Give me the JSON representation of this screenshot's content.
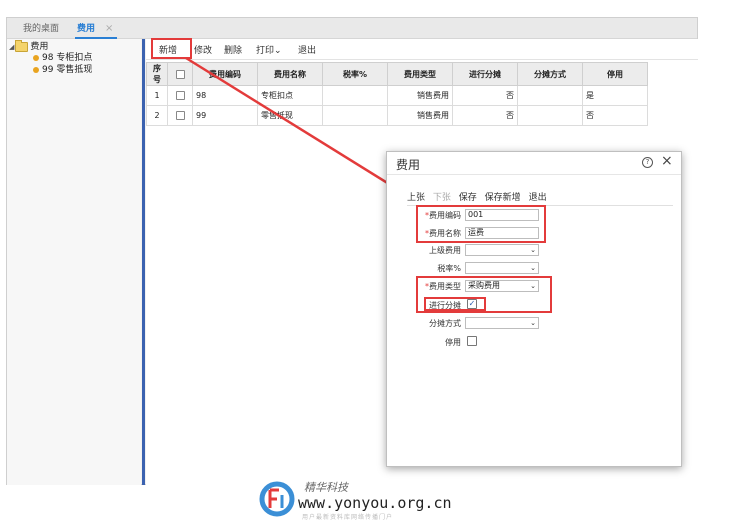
{
  "tabs": {
    "home": "我的桌面",
    "active": "费用",
    "close": "×"
  },
  "tree": {
    "root": "费用",
    "items": [
      {
        "label": "98 专柜扣点"
      },
      {
        "label": "99 零售抵现"
      }
    ]
  },
  "toolbar": {
    "add": "新增",
    "edit": "修改",
    "delete": "删除",
    "print": "打印",
    "print_arrow": "⌄",
    "exit": "退出"
  },
  "table": {
    "headers": [
      "序号",
      "",
      "费用编码",
      "费用名称",
      "税率%",
      "费用类型",
      "进行分摊",
      "分摊方式",
      "停用"
    ],
    "rows": [
      {
        "seq": "1",
        "code": "98",
        "name": "专柜扣点",
        "tax": "",
        "type": "销售费用",
        "share": "否",
        "method": "",
        "disabled": "是"
      },
      {
        "seq": "2",
        "code": "99",
        "name": "零售抵现",
        "tax": "",
        "type": "销售费用",
        "share": "否",
        "method": "",
        "disabled": "否"
      }
    ]
  },
  "dialog": {
    "title": "费用",
    "help": "?",
    "close": "×",
    "toolbar": {
      "prev": "上张",
      "next": "下张",
      "save": "保存",
      "save_new": "保存新增",
      "exit": "退出"
    },
    "fields": {
      "code_label": "费用编码",
      "code_value": "001",
      "name_label": "费用名称",
      "name_value": "运费",
      "parent_label": "上级费用",
      "parent_value": "",
      "tax_label": "税率%",
      "tax_value": "",
      "type_label": "费用类型",
      "type_value": "采购费用",
      "share_label": "进行分摊",
      "share_checked": true,
      "share_mark": "✓",
      "method_label": "分摊方式",
      "method_value": "",
      "disabled_label": "停用",
      "disabled_checked": false
    },
    "required_mark": "*",
    "select_arrow": "⌄"
  },
  "watermark": {
    "brand": "精华科技",
    "url": "www.yonyou.org.cn",
    "tagline": "用户最新资料库网络传播门户"
  },
  "colors": {
    "accent": "#2a7fd4",
    "highlight": "#e33b3b",
    "splitter": "#3b62b0",
    "folder": "#f4d36a",
    "leaf": "#e9a420"
  }
}
